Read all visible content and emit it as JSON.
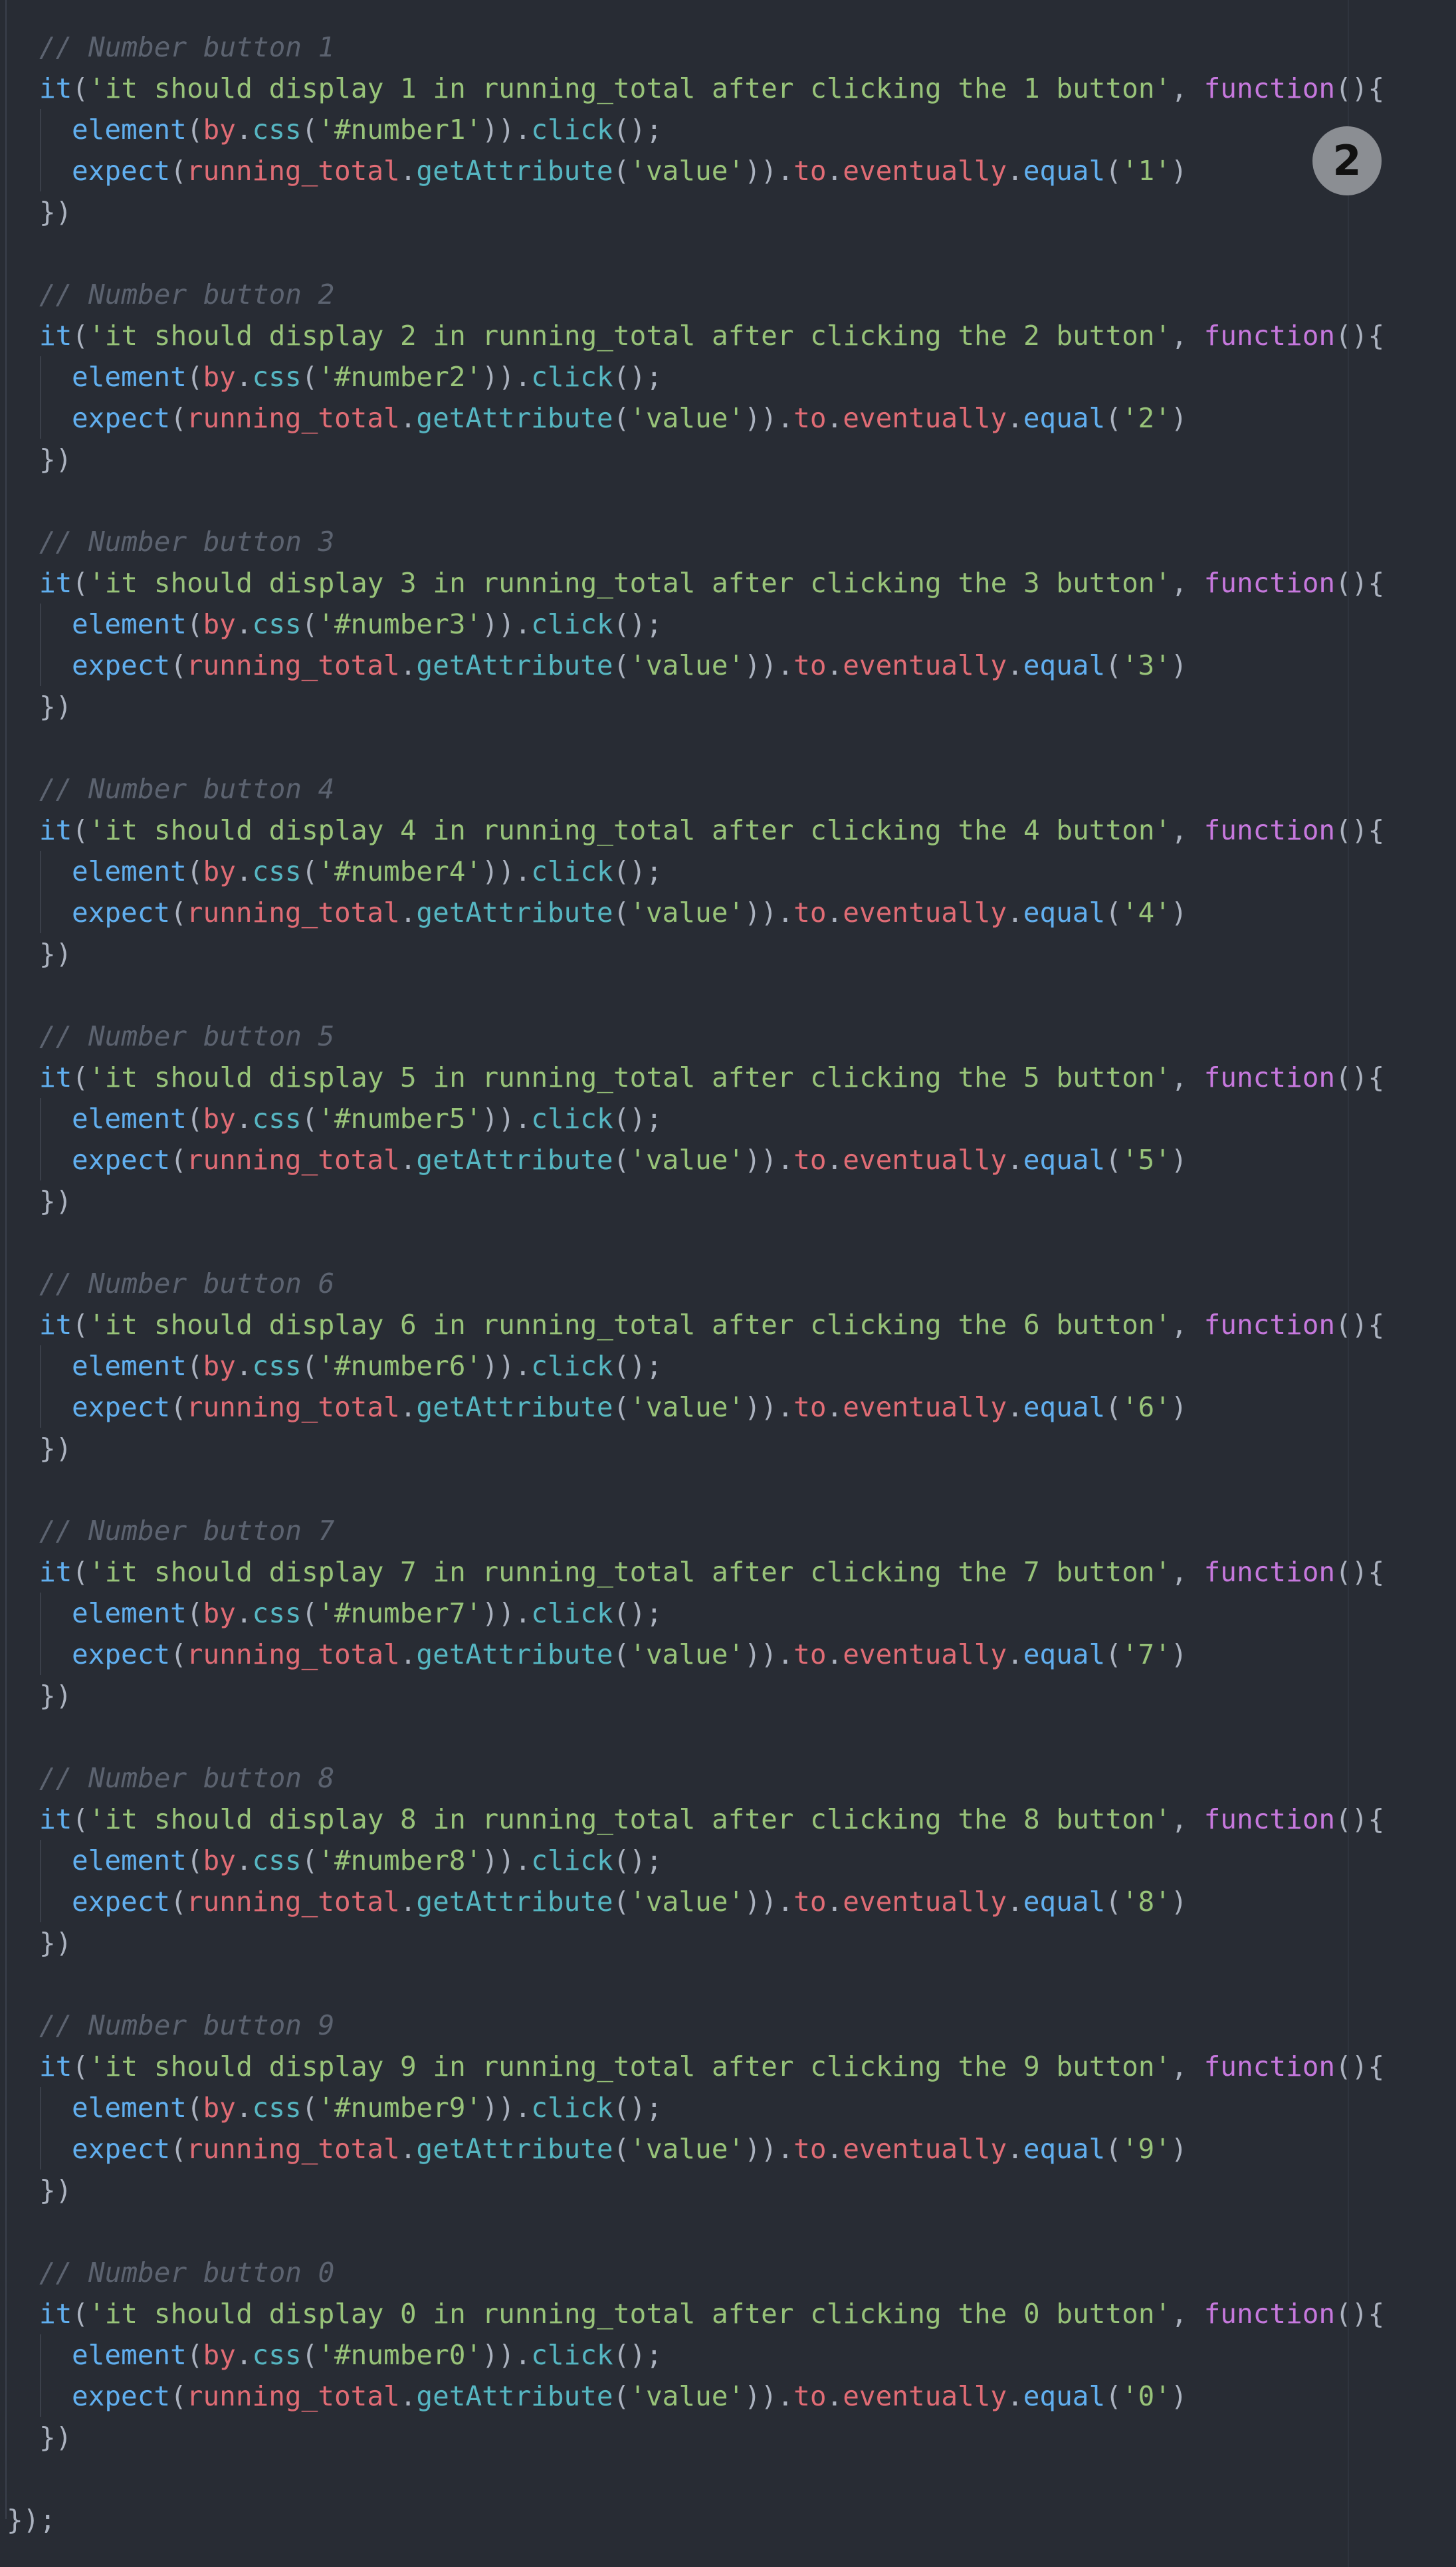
{
  "badge": "2",
  "blocks": [
    {
      "comment": "// Number button 1",
      "it": "it",
      "desc": "'it should display 1 in running_total after clicking the 1 button'",
      "kw": "function",
      "selector": "'#number1'",
      "expected": "'1'"
    },
    {
      "comment": "// Number button 2",
      "it": "it",
      "desc": "'it should display 2 in running_total after clicking the 2 button'",
      "kw": "function",
      "selector": "'#number2'",
      "expected": "'2'"
    },
    {
      "comment": "// Number button 3",
      "it": "it",
      "desc": "'it should display 3 in running_total after clicking the 3 button'",
      "kw": "function",
      "selector": "'#number3'",
      "expected": "'3'"
    },
    {
      "comment": "// Number button 4",
      "it": "it",
      "desc": "'it should display 4 in running_total after clicking the 4 button'",
      "kw": "function",
      "selector": "'#number4'",
      "expected": "'4'"
    },
    {
      "comment": "// Number button 5",
      "it": "it",
      "desc": "'it should display 5 in running_total after clicking the 5 button'",
      "kw": "function",
      "selector": "'#number5'",
      "expected": "'5'"
    },
    {
      "comment": "// Number button 6",
      "it": "it",
      "desc": "'it should display 6 in running_total after clicking the 6 button'",
      "kw": "function",
      "selector": "'#number6'",
      "expected": "'6'"
    },
    {
      "comment": "// Number button 7",
      "it": "it",
      "desc": "'it should display 7 in running_total after clicking the 7 button'",
      "kw": "function",
      "selector": "'#number7'",
      "expected": "'7'"
    },
    {
      "comment": "// Number button 8",
      "it": "it",
      "desc": "'it should display 8 in running_total after clicking the 8 button'",
      "kw": "function",
      "selector": "'#number8'",
      "expected": "'8'"
    },
    {
      "comment": "// Number button 9",
      "it": "it",
      "desc": "'it should display 9 in running_total after clicking the 9 button'",
      "kw": "function",
      "selector": "'#number9'",
      "expected": "'9'"
    },
    {
      "comment": "// Number button 0",
      "it": "it",
      "desc": "'it should display 0 in running_total after clicking the 0 button'",
      "kw": "function",
      "selector": "'#number0'",
      "expected": "'0'"
    }
  ],
  "tokens": {
    "element": "element",
    "by": "by",
    "css": "css",
    "click": "click",
    "expect": "expect",
    "running_total": "running_total",
    "getAttribute": "getAttribute",
    "value_arg": "'value'",
    "to": "to",
    "eventually": "eventually",
    "equal": "equal"
  },
  "closing": "});",
  "colors": {
    "background": "#282c34",
    "comment": "#5c6370",
    "function_call": "#61afef",
    "object": "#e06c75",
    "method": "#56b6c2",
    "string": "#98c379",
    "keyword": "#c678dd",
    "punctuation": "#abb2bf"
  }
}
